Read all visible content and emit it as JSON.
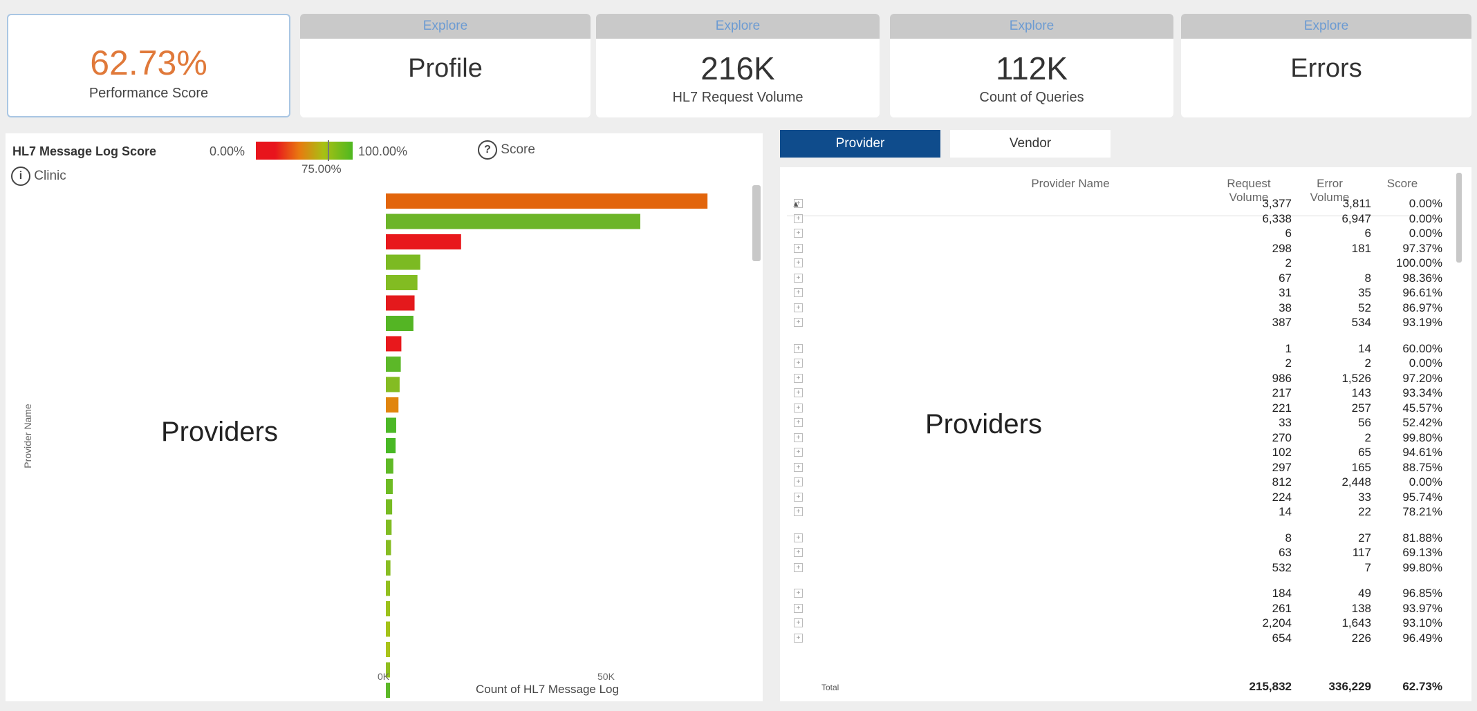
{
  "kpis": {
    "score": {
      "value": "62.73%",
      "label": "Performance Score"
    },
    "profile": {
      "explore": "Explore",
      "value": "Profile"
    },
    "hl7": {
      "explore": "Explore",
      "value": "216K",
      "label": "HL7 Request Volume"
    },
    "queries": {
      "explore": "Explore",
      "value": "112K",
      "label": "Count of Queries"
    },
    "errors": {
      "explore": "Explore",
      "value": "Errors"
    }
  },
  "left_panel": {
    "legend_title": "HL7 Message Log Score",
    "legend_min": "0.00%",
    "legend_max": "100.00%",
    "legend_mid": "75.00%",
    "score_label": "Score",
    "clinic_label": "Clinic",
    "watermark": "Providers"
  },
  "chart_data": {
    "type": "bar",
    "orientation": "horizontal",
    "ylabel": "Provider Name",
    "xlabel": "Count of HL7 Message Log",
    "x_ticks": [
      "0K",
      "50K"
    ],
    "xlim": [
      0,
      62000
    ],
    "values": [
      56000,
      44300,
      13100,
      6000,
      5500,
      5000,
      4800,
      2700,
      2600,
      2400,
      2200,
      1800,
      1700,
      1300,
      1200,
      1100,
      1000,
      900,
      800,
      700,
      700,
      600,
      600,
      500,
      500
    ],
    "colors": [
      "#e2650c",
      "#6cb528",
      "#e8181c",
      "#7cba22",
      "#82bc22",
      "#e4191c",
      "#54b524",
      "#e8181c",
      "#5cb828",
      "#84bc22",
      "#e1850d",
      "#4cb826",
      "#48b824",
      "#5fb926",
      "#6dbb23",
      "#77bb22",
      "#80bc22",
      "#86bc22",
      "#88bd22",
      "#92bf1e",
      "#9cc11b",
      "#a4c218",
      "#aac31a",
      "#90be20",
      "#5cb828"
    ]
  },
  "right_panel": {
    "tabs": [
      {
        "label": "Provider"
      },
      {
        "label": "Vendor"
      }
    ],
    "columns": {
      "name": "Provider Name",
      "req1": "Request",
      "req2": "Volume",
      "err1": "Error",
      "err2": "Volume",
      "score": "Score"
    },
    "watermark": "Providers",
    "rows": [
      {
        "req": "3,377",
        "err": "3,811",
        "score": "0.00%"
      },
      {
        "req": "6,338",
        "err": "6,947",
        "score": "0.00%"
      },
      {
        "req": "6",
        "err": "6",
        "score": "0.00%"
      },
      {
        "req": "298",
        "err": "181",
        "score": "97.37%"
      },
      {
        "req": "2",
        "err": "",
        "score": "100.00%"
      },
      {
        "req": "67",
        "err": "8",
        "score": "98.36%"
      },
      {
        "req": "31",
        "err": "35",
        "score": "96.61%"
      },
      {
        "req": "38",
        "err": "52",
        "score": "86.97%"
      },
      {
        "req": "387",
        "err": "534",
        "score": "93.19%"
      },
      {
        "req": "1",
        "err": "14",
        "score": "60.00%"
      },
      {
        "req": "2",
        "err": "2",
        "score": "0.00%"
      },
      {
        "req": "986",
        "err": "1,526",
        "score": "97.20%"
      },
      {
        "req": "217",
        "err": "143",
        "score": "93.34%"
      },
      {
        "req": "221",
        "err": "257",
        "score": "45.57%"
      },
      {
        "req": "33",
        "err": "56",
        "score": "52.42%"
      },
      {
        "req": "270",
        "err": "2",
        "score": "99.80%"
      },
      {
        "req": "102",
        "err": "65",
        "score": "94.61%"
      },
      {
        "req": "297",
        "err": "165",
        "score": "88.75%"
      },
      {
        "req": "812",
        "err": "2,448",
        "score": "0.00%"
      },
      {
        "req": "224",
        "err": "33",
        "score": "95.74%"
      },
      {
        "req": "14",
        "err": "22",
        "score": "78.21%"
      },
      {
        "req": "8",
        "err": "27",
        "score": "81.88%"
      },
      {
        "req": "63",
        "err": "117",
        "score": "69.13%"
      },
      {
        "req": "532",
        "err": "7",
        "score": "99.80%"
      },
      {
        "req": "184",
        "err": "49",
        "score": "96.85%"
      },
      {
        "req": "261",
        "err": "138",
        "score": "93.97%"
      },
      {
        "req": "2,204",
        "err": "1,643",
        "score": "93.10%"
      },
      {
        "req": "654",
        "err": "226",
        "score": "96.49%"
      }
    ],
    "total": {
      "label": "Total",
      "req": "215,832",
      "err": "336,229",
      "score": "62.73%"
    }
  }
}
